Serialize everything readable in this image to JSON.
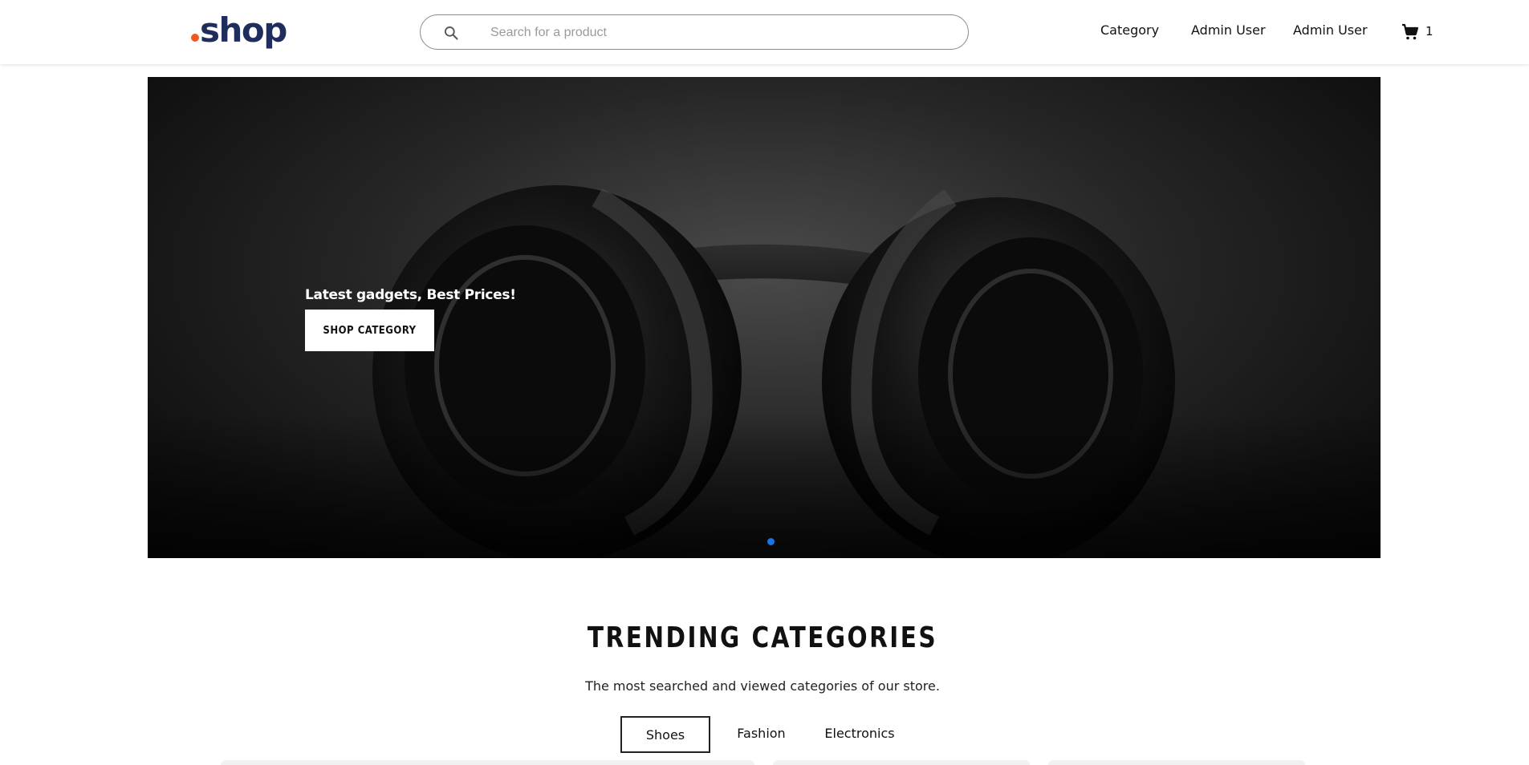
{
  "header": {
    "logo_text": "shop",
    "logo_dot_color": "#f05a22",
    "logo_color": "#1f2d5c",
    "search": {
      "placeholder": "Search for a product",
      "value": "",
      "icon": "search-icon"
    },
    "nav": {
      "category": "Category",
      "user1": "Admin User",
      "user2": "Admin User"
    },
    "cart": {
      "icon": "cart-icon",
      "count": "1"
    }
  },
  "hero": {
    "tagline": "Latest gadgets, Best Prices!",
    "button_label": "SHOP CATEGORY",
    "active_dot_color": "#1a73e8"
  },
  "trending": {
    "title": "TRENDING CATEGORIES",
    "subtitle": "The most searched and viewed categories of our store.",
    "tabs": [
      {
        "label": "Shoes",
        "active": true
      },
      {
        "label": "Fashion",
        "active": false
      },
      {
        "label": "Electronics",
        "active": false
      }
    ]
  }
}
